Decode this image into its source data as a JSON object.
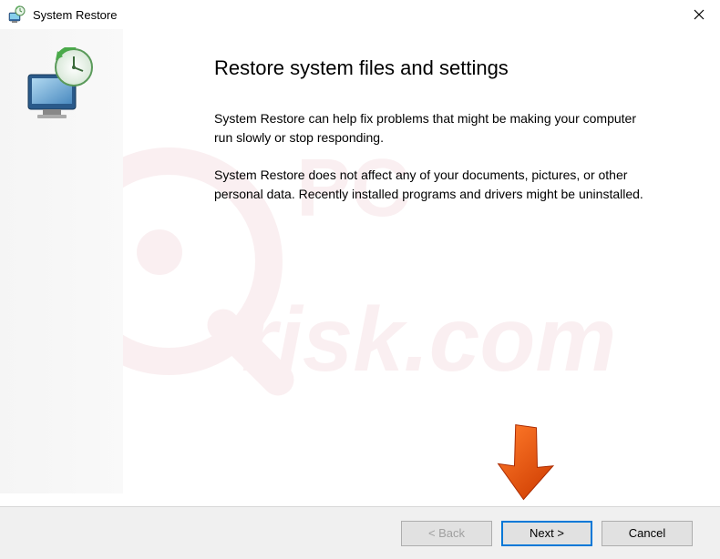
{
  "window": {
    "title": "System Restore"
  },
  "content": {
    "heading": "Restore system files and settings",
    "paragraph1": "System Restore can help fix problems that might be making your computer run slowly or stop responding.",
    "paragraph2": "System Restore does not affect any of your documents, pictures, or other personal data. Recently installed programs and drivers might be uninstalled."
  },
  "buttons": {
    "back": "< Back",
    "next": "Next >",
    "cancel": "Cancel"
  }
}
